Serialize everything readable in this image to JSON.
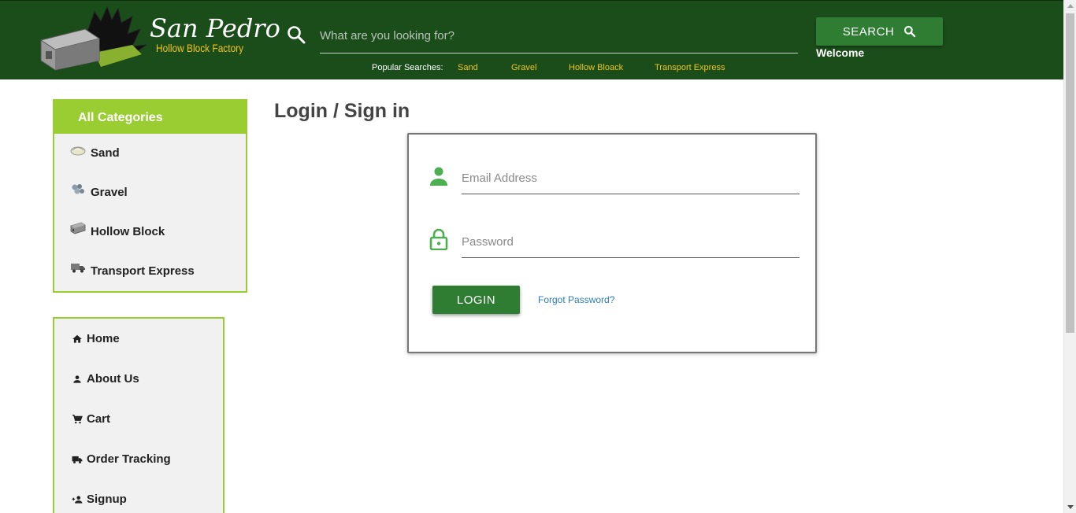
{
  "brand": {
    "title": "San Pedro",
    "subtitle": "Hollow Block Factory",
    "logo_icon": "hollow-block-with-wings-logo"
  },
  "header": {
    "search_placeholder": "What are you looking for?",
    "search_button": "SEARCH",
    "welcome": "Welcome",
    "popular_label": "Popular Searches:",
    "popular": [
      "Sand",
      "Gravel",
      "Hollow Bloack",
      "Transport Express"
    ]
  },
  "categories": {
    "title": "All Categories",
    "items": [
      {
        "label": "Sand",
        "icon": "sand-icon"
      },
      {
        "label": "Gravel",
        "icon": "gravel-icon"
      },
      {
        "label": "Hollow Block",
        "icon": "hollow-block-icon"
      },
      {
        "label": "Transport Express",
        "icon": "truck-icon"
      }
    ]
  },
  "nav": {
    "items": [
      {
        "label": "Home",
        "icon": "home-icon"
      },
      {
        "label": "About Us",
        "icon": "person-icon"
      },
      {
        "label": "Cart",
        "icon": "cart-icon"
      },
      {
        "label": "Order Tracking",
        "icon": "truck-icon"
      },
      {
        "label": "Signup",
        "icon": "person-add-icon"
      }
    ]
  },
  "main": {
    "title": "Login / Sign in",
    "email_placeholder": "Email Address",
    "email_value": "",
    "password_placeholder": "Password",
    "password_value": "",
    "login_button": "LOGIN",
    "forgot_link": "Forgot Password?"
  },
  "colors": {
    "header_bg": "#1b4d1b",
    "accent_green": "#2e7d32",
    "lime": "#9acd32",
    "gold": "#f0c419",
    "link_blue": "#2a7fb8"
  }
}
